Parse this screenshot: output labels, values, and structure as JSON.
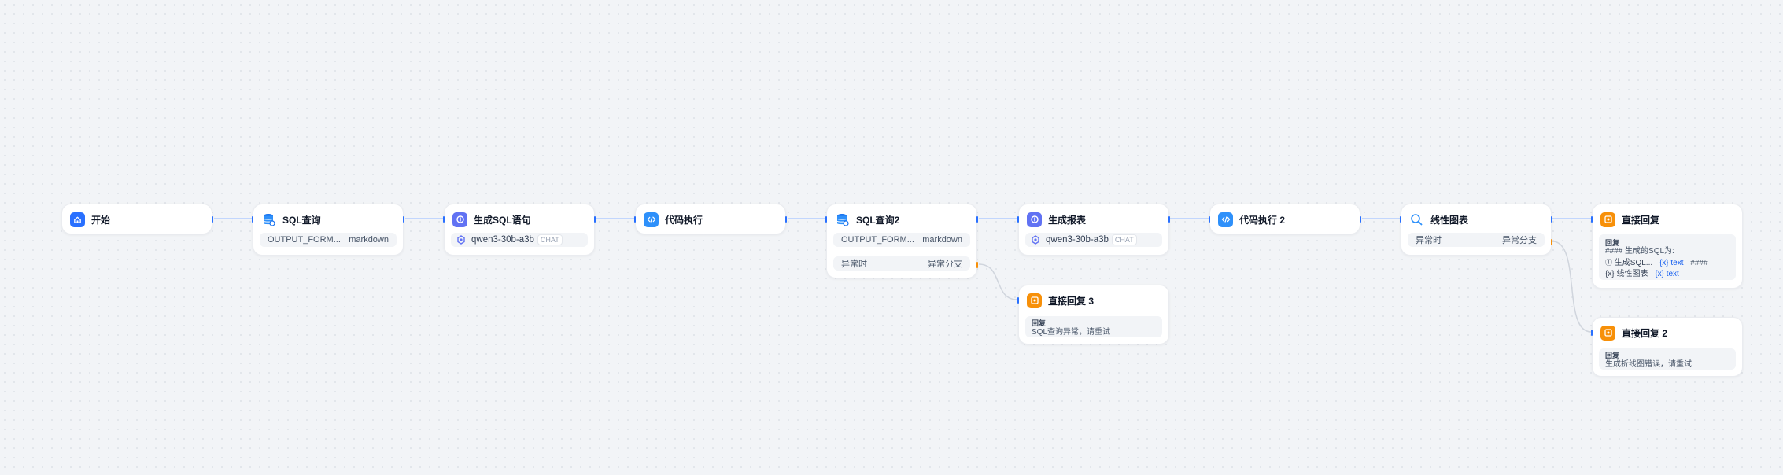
{
  "nodes": {
    "start": {
      "title": "开始"
    },
    "sql_query": {
      "title": "SQL查询",
      "row_label": "OUTPUT_FORM...",
      "row_value": "markdown"
    },
    "gen_sql": {
      "title": "生成SQL语句",
      "model": "qwen3-30b-a3b",
      "mode": "CHAT"
    },
    "code_exec": {
      "title": "代码执行"
    },
    "sql_query2": {
      "title": "SQL查询2",
      "row_label": "OUTPUT_FORM...",
      "row_value": "markdown",
      "branch_label": "异常时",
      "branch_value": "异常分支"
    },
    "gen_report": {
      "title": "生成报表",
      "model": "qwen3-30b-a3b",
      "mode": "CHAT"
    },
    "code_exec2": {
      "title": "代码执行 2"
    },
    "line_chart": {
      "title": "线性图表",
      "branch_label": "异常时",
      "branch_value": "异常分支"
    },
    "reply": {
      "title": "直接回复",
      "reply_label": "回复",
      "line1": "#### 生成的SQL为:",
      "line2_a": "生成SQL...",
      "line2_b": "{x} text",
      "line2_c": "####",
      "line3_a": "{x} 线性图表",
      "line3_b": "{x} text"
    },
    "reply3": {
      "title": "直接回复 3",
      "reply_label": "回复",
      "content": "SQL查询异常，请重试"
    },
    "reply2": {
      "title": "直接回复 2",
      "reply_label": "回复",
      "content": "生成折线图错误，请重试"
    }
  },
  "colors": {
    "blue": "#2970ff",
    "indigo": "#6172f3",
    "sky": "#2e90fa",
    "orange": "#f79009"
  },
  "icons": {
    "start": "home-icon",
    "sql": "database-icon",
    "llm": "brain-icon",
    "code": "code-icon",
    "chart": "chart-search-icon",
    "reply": "reply-icon",
    "model": "model-provider-icon"
  }
}
